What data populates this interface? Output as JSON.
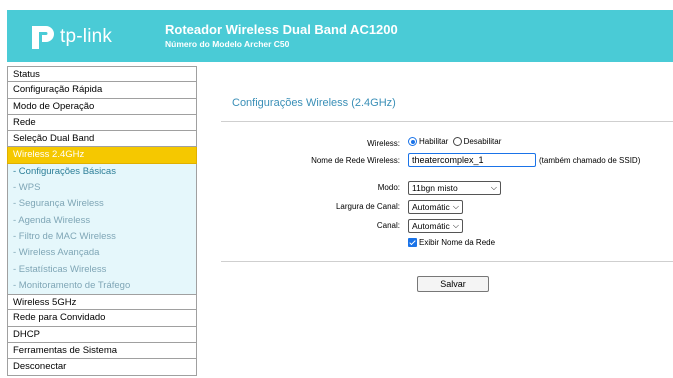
{
  "brand": {
    "logo_text": "tp-link",
    "icon": "tp-link-logo-icon",
    "accent": "#4acbd6"
  },
  "header": {
    "title": "Roteador Wireless Dual Band AC1200",
    "subtitle": "Número do Modelo Archer C50"
  },
  "sidebar": {
    "items_top": [
      {
        "label": "Status"
      },
      {
        "label": "Configuração Rápida"
      },
      {
        "label": "Modo de Operação"
      },
      {
        "label": "Rede"
      },
      {
        "label": "Seleção Dual Band"
      }
    ],
    "active": {
      "label": "Wireless 2.4GHz",
      "color": "#f5c800"
    },
    "subitems": [
      {
        "label": "- Configurações Básicas"
      },
      {
        "label": "- WPS"
      },
      {
        "label": "- Segurança Wireless"
      },
      {
        "label": "- Agenda Wireless"
      },
      {
        "label": "- Filtro de MAC Wireless"
      },
      {
        "label": "- Wireless Avançada"
      },
      {
        "label": "- Estatísticas Wireless"
      },
      {
        "label": "- Monitoramento de Tráfego"
      }
    ],
    "items_bottom": [
      {
        "label": "Wireless 5GHz"
      },
      {
        "label": "Rede para Convidado"
      },
      {
        "label": "DHCP"
      },
      {
        "label": "Ferramentas de Sistema"
      },
      {
        "label": "Desconectar"
      }
    ]
  },
  "main": {
    "section_title": "Configurações Wireless (2.4GHz)",
    "wireless": {
      "label": "Wireless:",
      "enable": "Habilitar",
      "disable": "Desabilitar",
      "selected": "Habilitar"
    },
    "ssid": {
      "label": "Nome de Rede Wireless:",
      "value": "theatercomplex_1",
      "hint": "(também chamado de SSID)"
    },
    "mode": {
      "label": "Modo:",
      "value": "11bgn misto"
    },
    "channel_width": {
      "label": "Largura de Canal:",
      "value": "Automátic"
    },
    "channel": {
      "label": "Canal:",
      "value": "Automátic"
    },
    "broadcast": {
      "label": "Exibir Nome da Rede",
      "checked": true
    },
    "save_label": "Salvar"
  }
}
